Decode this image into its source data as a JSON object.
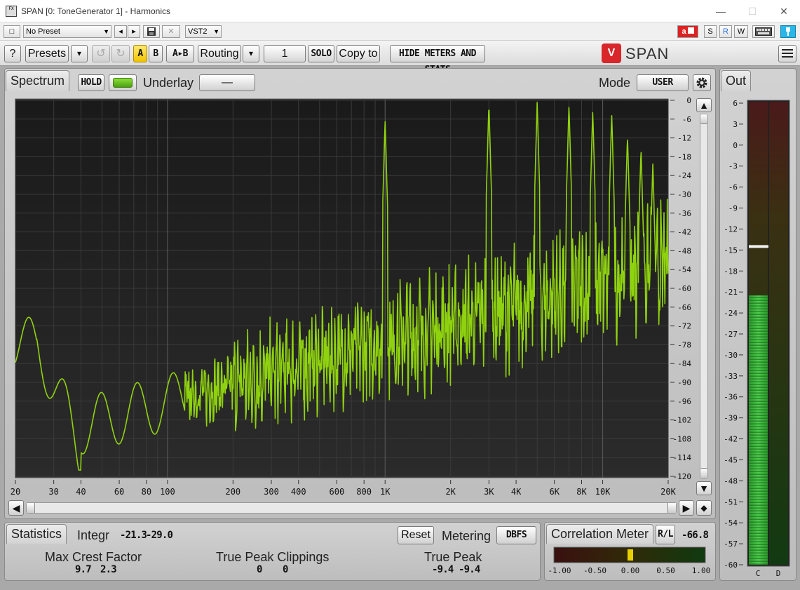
{
  "window": {
    "title": "SPAN [0: ToneGenerator 1] - Harmonics",
    "icon_text": "FX",
    "minimize": "—",
    "maximize": "☐",
    "close": "✕"
  },
  "host": {
    "preset_button": "□",
    "preset": "No Preset",
    "prev": "◂",
    "next": "▸",
    "save_icon": "save-icon",
    "clear": "✕",
    "plugin_format": "VST2",
    "a_label": "a",
    "s_label": "S",
    "r_label": "R",
    "w_label": "W"
  },
  "toolbar": {
    "help": "?",
    "presets": "Presets",
    "dropdown": "▾",
    "undo": "↺",
    "redo": "↻",
    "a": "A",
    "b": "B",
    "ab": "A▸B",
    "routing": "Routing",
    "channel": "1",
    "solo": "SOLO",
    "copy_to": "Copy to",
    "hide_meters": "HIDE METERS AND STATS",
    "brand": "SPAN",
    "brand_mark": "V"
  },
  "spectrum": {
    "tab": "Spectrum",
    "hold": "HOLD",
    "underlay_label": "Underlay",
    "underlay_value": "—",
    "mode_label": "Mode",
    "mode_value": "USER",
    "freq_labels": [
      "20",
      "30",
      "40",
      "60",
      "80",
      "100",
      "200",
      "300",
      "400",
      "600",
      "800",
      "1K",
      "2K",
      "3K",
      "4K",
      "6K",
      "8K",
      "10K",
      "20K"
    ],
    "db_labels": [
      "0",
      "-6",
      "-12",
      "-18",
      "-24",
      "-30",
      "-36",
      "-42",
      "-48",
      "-54",
      "-60",
      "-66",
      "-72",
      "-78",
      "-84",
      "-90",
      "-96",
      "-102",
      "-108",
      "-114",
      "-120"
    ],
    "scroll_up": "▲",
    "scroll_down": "▼",
    "scroll_left": "◀",
    "scroll_right": "▶",
    "scroll_diamond": "◆"
  },
  "statistics": {
    "tab": "Statistics",
    "integr_label": "Integr",
    "integr_l": "-21.3",
    "integr_r": "-29.0",
    "reset": "Reset",
    "metering_label": "Metering",
    "metering_value": "DBFS",
    "max_crest_label": "Max Crest Factor",
    "max_crest_l": "9.7",
    "max_crest_r": "2.3",
    "clip_label": "True Peak Clippings",
    "clip_l": "0",
    "clip_r": "0",
    "true_peak_label": "True Peak",
    "true_peak_l": "-9.4",
    "true_peak_r": "-9.4"
  },
  "correlation": {
    "tab": "Correlation Meter",
    "rl_label": "R/L",
    "rl_value": "-66.8",
    "scale": [
      "-1.00",
      "-0.50",
      "0.00",
      "0.50",
      "1.00"
    ],
    "value": 0.0
  },
  "out_meter": {
    "tab": "Out",
    "scale": [
      "6",
      "3",
      "0",
      "-3",
      "-6",
      "-9",
      "-12",
      "-15",
      "-18",
      "-21",
      "-24",
      "-27",
      "-30",
      "-33",
      "-36",
      "-39",
      "-42",
      "-45",
      "-48",
      "-51",
      "-54",
      "-57",
      "-60"
    ],
    "level_db": -21.5,
    "peak_marker_db": -14.5,
    "channels": [
      "C",
      "D"
    ]
  },
  "colors": {
    "spectrum_line": "#8fd20f",
    "meter_green": "#3db83d",
    "accent_cyan": "#29b6e8",
    "accent_red": "#d8262a"
  }
}
